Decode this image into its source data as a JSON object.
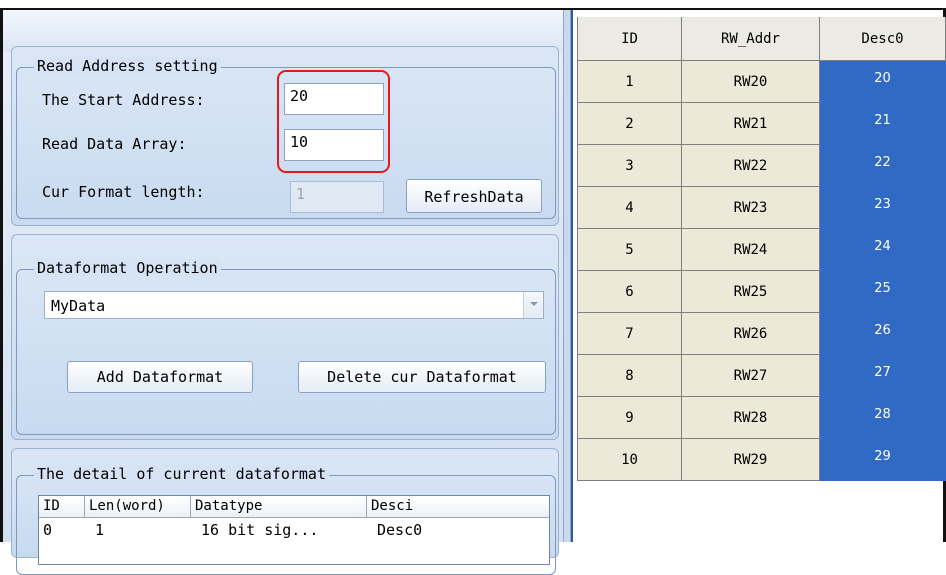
{
  "read_address": {
    "legend": "Read Address setting",
    "start_label": "The Start Address:",
    "start_value": "20",
    "array_label": "Read Data Array:",
    "array_value": "10",
    "format_len_label": "Cur Format length:",
    "format_len_value": "1",
    "refresh_button": "RefreshData"
  },
  "dataformat_op": {
    "legend": "Dataformat Operation",
    "selected": "MyData",
    "add_button": "Add Dataformat",
    "delete_button": "Delete cur Dataformat"
  },
  "detail": {
    "legend": "The detail of current dataformat",
    "columns": [
      "ID",
      "Len(word)",
      "Datatype",
      "Desci"
    ],
    "rows": [
      [
        "0",
        "1",
        "16 bit sig...",
        "Desc0"
      ]
    ]
  },
  "grid": {
    "columns": [
      "ID",
      "RW_Addr",
      "Desc0"
    ],
    "rows": [
      [
        "1",
        "RW20",
        "20"
      ],
      [
        "2",
        "RW21",
        "21"
      ],
      [
        "3",
        "RW22",
        "22"
      ],
      [
        "4",
        "RW23",
        "23"
      ],
      [
        "5",
        "RW24",
        "24"
      ],
      [
        "6",
        "RW25",
        "25"
      ],
      [
        "7",
        "RW26",
        "26"
      ],
      [
        "8",
        "RW27",
        "27"
      ],
      [
        "9",
        "RW28",
        "28"
      ],
      [
        "10",
        "RW29",
        "29"
      ]
    ],
    "selection_color": "#316ac5"
  },
  "annotation": {
    "color": "#e51919"
  }
}
